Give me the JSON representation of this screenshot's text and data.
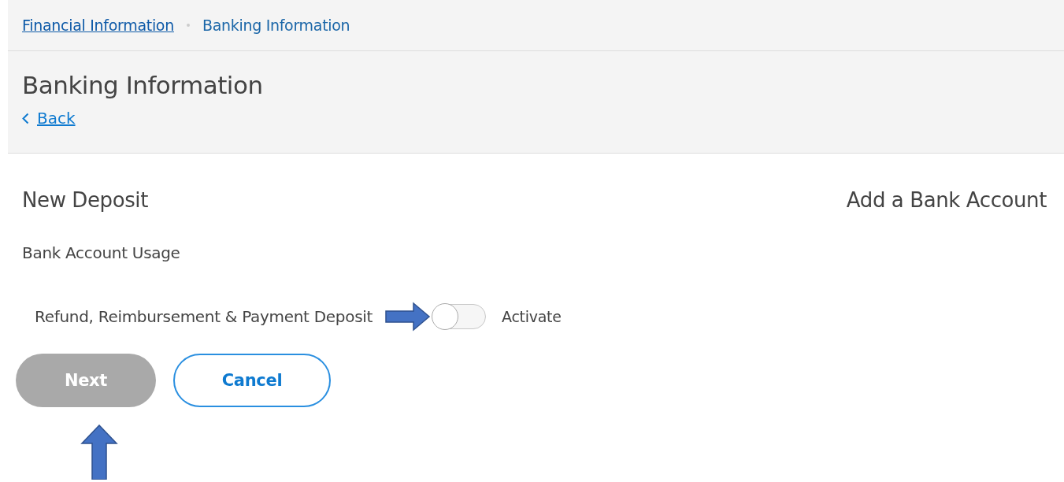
{
  "breadcrumbs": [
    {
      "label": "Financial Information",
      "kind": "link"
    },
    {
      "label": "Banking Information",
      "kind": "current"
    }
  ],
  "header": {
    "title": "Banking Information",
    "back_link": "Back"
  },
  "section": {
    "title": "New Deposit",
    "action_link": "Add a Bank Account"
  },
  "usage": {
    "heading": "Bank Account Usage",
    "option": "Refund, Reimbursement & Payment Deposit",
    "toggle_on": false,
    "toggle_label": "Activate"
  },
  "buttons": [
    {
      "label": "Next",
      "kind": "primary",
      "disabled": true
    },
    {
      "label": "Cancel",
      "kind": "secondary",
      "disabled": false
    }
  ]
}
